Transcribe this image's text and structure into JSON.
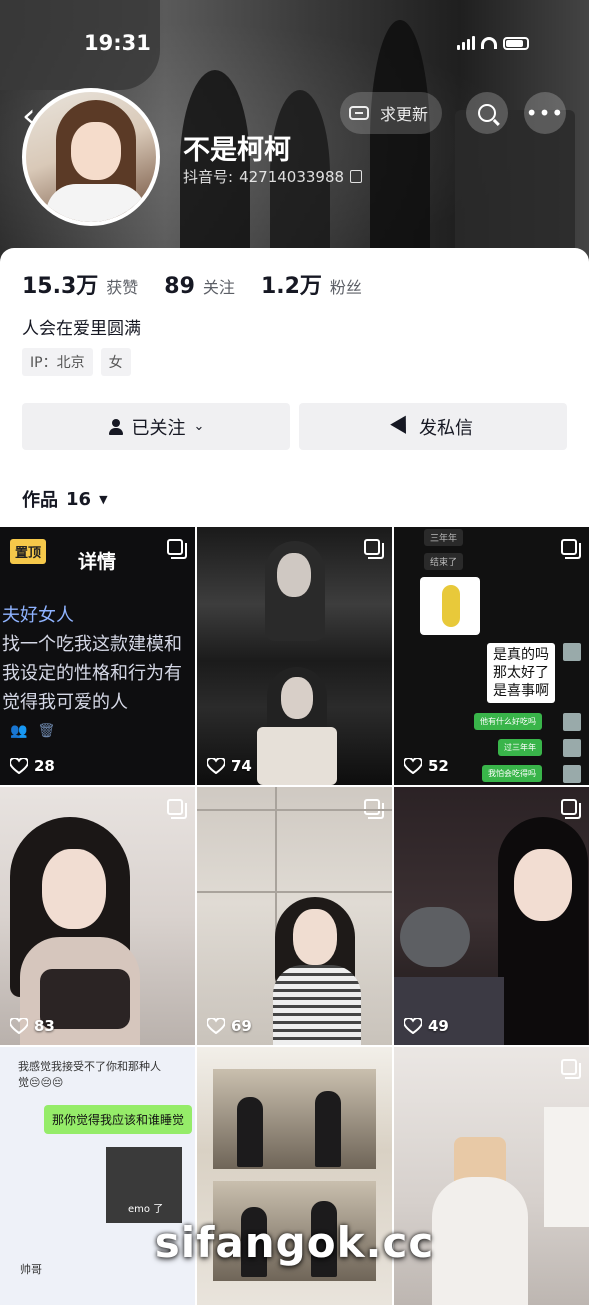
{
  "status_bar": {
    "time": "19:31"
  },
  "header": {
    "back_icon": "chevron-left-icon",
    "update_label": "求更新",
    "search_icon": "search-icon",
    "more_icon": "more-icon",
    "more_glyph": "•••"
  },
  "profile": {
    "username": "不是柯柯",
    "douyin_id_label": "抖音号:",
    "douyin_id": "42714033988",
    "stats": [
      {
        "value": "15.3万",
        "label": "获赞"
      },
      {
        "value": "89",
        "label": "关注"
      },
      {
        "value": "1.2万",
        "label": "粉丝"
      }
    ],
    "bio": "人会在爱里圆满",
    "tags": [
      "IP：北京",
      "女"
    ],
    "follow_button": "已关注",
    "message_button": "发私信"
  },
  "works": {
    "label": "作品",
    "count": "16",
    "tiles": [
      {
        "likes": "28",
        "pinned": "置顶",
        "title": "详情",
        "lines": [
          "夫好女人",
          "找一个吃我这款建模和",
          "我设定的性格和行为有",
          "觉得我可爱的人"
        ]
      },
      {
        "likes": "74"
      },
      {
        "likes": "52",
        "chips": [
          "三年年",
          "结束了"
        ],
        "bubble": [
          "是真的吗",
          "那太好了",
          "是喜事啊"
        ],
        "green_chips": [
          "他有什么好吃吗",
          "过三年年",
          "我怕会吃得吗"
        ]
      },
      {
        "likes": "83"
      },
      {
        "likes": "69"
      },
      {
        "likes": "49"
      },
      {
        "likes": "",
        "top_text": [
          "我感觉我接受不了你和那种人",
          "觉😔😔😔"
        ],
        "green_text": "那你觉得我应该和谁睡觉",
        "image_caption": "emo 了",
        "bottom_label": "帅哥"
      },
      {
        "likes": ""
      },
      {
        "likes": ""
      }
    ]
  },
  "watermark": "sifangok.cc",
  "colors": {
    "pin_badge": "#f5c84a",
    "button_bg": "#f0f0f2",
    "text_primary": "#161823",
    "chat_green": "#95ec69"
  }
}
